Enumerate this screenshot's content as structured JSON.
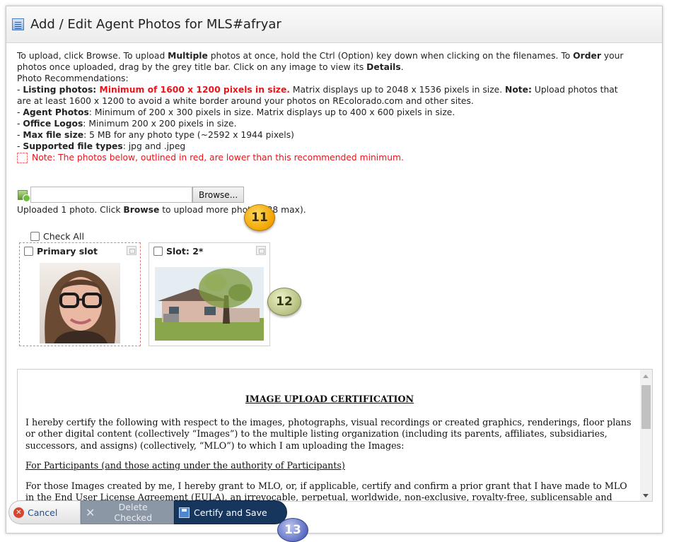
{
  "title": "Add / Edit Agent Photos for MLS#afryar",
  "instructions": {
    "l1_a": "To upload, click Browse. To upload ",
    "l1_b": "Multiple",
    "l1_c": " photos at once, hold the Ctrl (Option) key down when clicking on the filenames. To ",
    "l1_d": "Order",
    "l1_e": " your",
    "l2_a": "photos once uploaded, drag by the grey title bar. Click on any image to view its ",
    "l2_b": "Details",
    "l2_c": ".",
    "l3": "Photo Recommendations:",
    "lp_a": "- ",
    "lp_b": "Listing photos: ",
    "lp_c": "Minimum of 1600 x 1200 pixels in size.",
    "lp_d": " Matrix displays up to 2048 x 1536 pixels in size. ",
    "lp_e": "Note:",
    "lp_f": " Upload photos that",
    "lp2": "are at least 1600 x 1200 to avoid a white border around your photos on REcolorado.com and other sites.",
    "ap_b": "Agent Photos",
    "ap_c": ": Minimum of 200 x 300 pixels in size. Matrix displays up to 400 x 600 pixels in size.",
    "ol_b": "Office Logos",
    "ol_c": ": Minimum 200 x 200 pixels in size.",
    "mf_b": "Max file size",
    "mf_c": ": 5 MB for any photo type (~2592 x 1944 pixels)",
    "sf_b": "Supported file types",
    "sf_c": ": jpg and .jpeg",
    "dash": "- ",
    "note_red": "Note: The photos below, outlined in red, are lower than this recommended minimum."
  },
  "upload": {
    "file_value": "",
    "browse_label": "Browse...",
    "status_a": "Uploaded 1 photo. Click ",
    "status_b": "Browse",
    "status_c": " to upload more photos (38 max)."
  },
  "callouts": {
    "c11": "11",
    "c12": "12",
    "c13": "13"
  },
  "photos": {
    "check_all": "Check All",
    "slots": [
      {
        "label": "Primary slot"
      },
      {
        "label": "Slot: 2*"
      }
    ]
  },
  "certification": {
    "heading": "IMAGE UPLOAD CERTIFICATION",
    "p1": "I hereby certify the following with respect to the images, photographs, visual recordings or created graphics, renderings, floor plans or other digital content (collectively “Images”) to the multiple listing organization (including its parents, affiliates, subsidiaries, successors, and assigns) (collectively, “MLO”) to which I am uploading the Images:",
    "p2": "For Participants (and those acting under the authority of Participants)",
    "p3": "For those Images created by me, I hereby grant to MLO, or, if applicable, certify and confirm a prior grant that I have made to MLO in the End User License Agreement (EULA), an irrevocable, perpetual, worldwide, non-exclusive, royalty-free, sublicensable and"
  },
  "footer": {
    "cancel": "Cancel",
    "delete": "Delete Checked",
    "save": "Certify and Save"
  },
  "colors": {
    "accent_red": "#e8151b",
    "save_bg": "#17365d",
    "delete_bg": "#8b97a5",
    "callout_11": "#f2a300",
    "callout_12": "#b6bf80",
    "callout_13": "#5d6fc4"
  }
}
